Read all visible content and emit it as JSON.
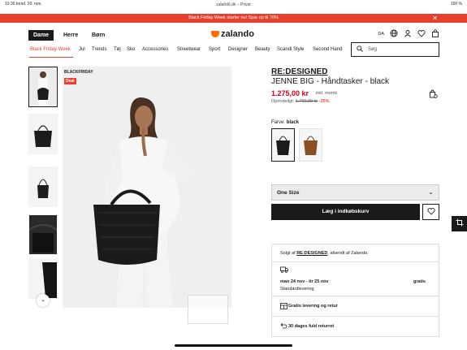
{
  "status": {
    "time": "10.30 torsd. 20. nov.",
    "url": "zalando.dk – Privat",
    "right": "100 %",
    "dots": "• • •"
  },
  "promo": {
    "text": "Black Friday Week starter nu! Spar op til 70%",
    "close": "✕"
  },
  "header": {
    "genders": [
      "Dame",
      "Herre",
      "Børn"
    ],
    "logo": "zalando",
    "lang": "DA",
    "icons": [
      "globe-icon",
      "user-icon",
      "heart-icon",
      "bag-icon"
    ]
  },
  "nav": {
    "items": [
      "Black Friday Week",
      "Jul",
      "Trends",
      "Tøj",
      "Sko",
      "Accessories",
      "Streetwear",
      "Sport",
      "Designer",
      "Beauty",
      "Scandi Style",
      "Second Hand"
    ],
    "search_placeholder": "Søg"
  },
  "gallery": {
    "badge": "BLACKFRIDAY",
    "deal": "Deal",
    "thumb_count": 5
  },
  "product": {
    "brand": "RE:DESIGNED",
    "name": "JENNE BIG - Håndtasker - black",
    "price": "1.275,00 kr",
    "vat": "inkl. moms",
    "orig_label": "Oprindeligt:",
    "orig_price": "1.700,00 kr",
    "discount": "-25%",
    "color_label": "Farve:",
    "color_value": "black",
    "colors": [
      "black",
      "brown"
    ],
    "size_label": "One Size",
    "cart_label": "Læg i indkøbskurv"
  },
  "shipping": {
    "sold_prefix": "Solgt af",
    "seller": "RE:DESIGNED",
    "sold_suffix": ", afsendt af Zalando.",
    "dates": "man 24 nov - tir 25 nov",
    "price": "gratis",
    "standard": "Standardlevering",
    "free": "Gratis levering og retur",
    "returns": "30 dages fuld returret"
  },
  "colors": {
    "accent": "#e8402e",
    "brand_orange": "#ff6900",
    "price_red": "#d0021b"
  }
}
